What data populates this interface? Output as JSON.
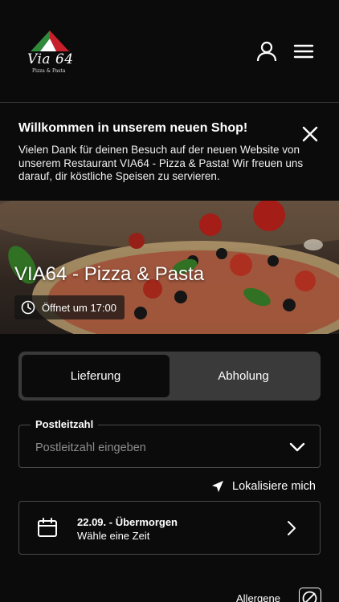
{
  "header": {
    "logo_text": "Via 64",
    "logo_subtext": "Pizza & Pasta",
    "account_icon": "user-icon",
    "menu_icon": "hamburger-menu-icon"
  },
  "banner": {
    "title": "Willkommen in unserem neuen Shop!",
    "text": "Vielen Dank für deinen Besuch auf der neuen Website von unserem Restaurant VIA64 - Pizza & Pasta! Wir freuen uns darauf, dir köstliche Speisen zu servieren.",
    "close_icon": "close-icon"
  },
  "hero": {
    "restaurant_name": "VIA64 - Pizza & Pasta",
    "hours": "Öffnet um 17:00",
    "clock_icon": "clock-icon"
  },
  "order_mode": {
    "options": [
      "Lieferung",
      "Abholung"
    ],
    "selected": "Lieferung"
  },
  "postcode": {
    "label": "Postleitzahl",
    "placeholder": "Postleitzahl eingeben",
    "chevron_icon": "chevron-down-icon"
  },
  "locate": {
    "label": "Lokalisiere mich",
    "icon": "location-arrow-icon"
  },
  "timeslot": {
    "date": "22.09. - Übermorgen",
    "subtitle": "Wähle eine Zeit",
    "calendar_icon": "calendar-icon",
    "chevron_icon": "chevron-right-icon"
  },
  "footer": {
    "allergen_label": "Allergene",
    "allergen_icon": "no-allergen-icon"
  },
  "colors": {
    "background": "#0b0b0b",
    "toggle_bg": "#3a3a3a",
    "border": "#4a4a4a",
    "logo_red": "#c8202a",
    "logo_green": "#2f8a3a"
  }
}
